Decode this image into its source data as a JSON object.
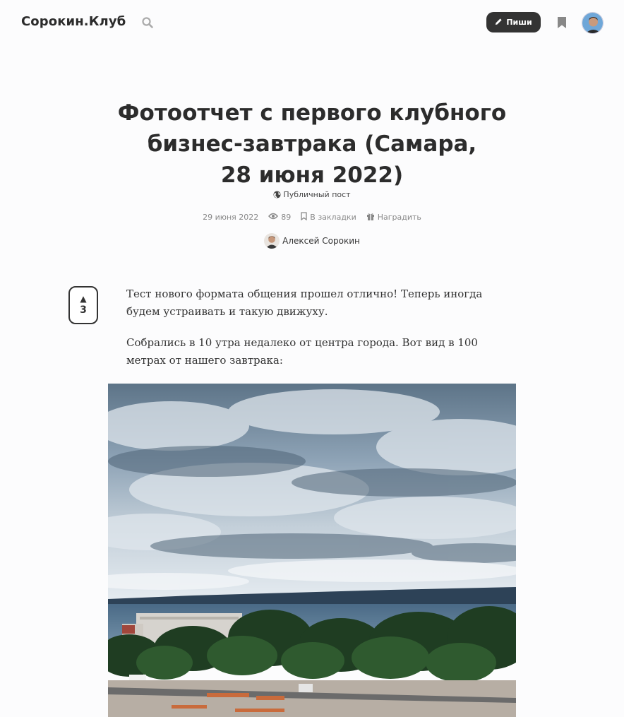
{
  "header": {
    "logo": "Сорокин.Клуб",
    "write_label": "Пиши",
    "icons": {
      "search": "search-icon",
      "pencil": "pencil-icon",
      "bookmark": "bookmark-icon",
      "avatar": "user-avatar"
    },
    "accent_color": "#333333"
  },
  "post": {
    "title_lines": [
      "Фотоотчет с первого клубного",
      "бизнес-завтрака (Самара,",
      "28 июня 2022)"
    ],
    "visibility": "Публичный пост",
    "meta": {
      "date": "29 июня 2022",
      "views": "89",
      "bookmark_label": "В закладки",
      "reward_label": "Наградить"
    },
    "author": "Алексей Сорокин",
    "upvotes": "3",
    "upvote_arrow": "▲",
    "paragraphs": [
      "Тест нового формата общения прошел отлично! Теперь иногда будем устраивать и такую движуху.",
      "Собрались в 10 утра недалеко от центра города. Вот вид в 100 метрах от нашего завтрака:"
    ]
  }
}
